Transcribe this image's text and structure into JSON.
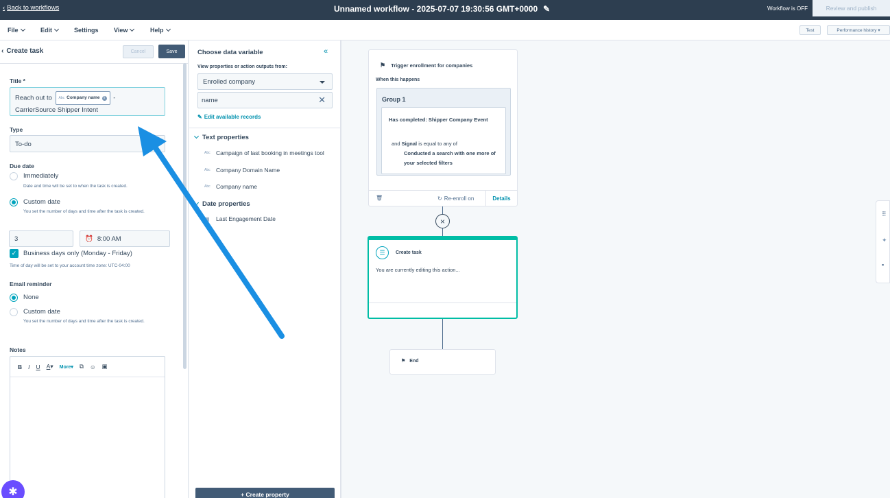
{
  "topbar": {
    "back_label": "Back to workflows",
    "title": "Unnamed workflow - 2025-07-07 19:30:56 GMT+0000",
    "status": "Workflow is OFF",
    "review_label": "Review and publish"
  },
  "menu": {
    "items": [
      "File",
      "Edit",
      "Settings",
      "View",
      "Help"
    ],
    "test_label": "Test",
    "perf_label": "Performance history"
  },
  "left": {
    "title": "Create task",
    "cancel": "Cancel",
    "save": "Save",
    "title_label": "Title *",
    "title_prefix": "Reach out to",
    "token_label": "Company name",
    "token_abc": "Abc",
    "title_suffix": "-",
    "title_line2": "CarrierSource Shipper Intent",
    "type_label": "Type",
    "type_value": "To-do",
    "due_label": "Due date",
    "immediately": "Immediately",
    "immediately_help": "Date and time will be set to when the task is created.",
    "custom_date": "Custom date",
    "custom_help": "You set the number of days and time after the task is created.",
    "days_value": "3",
    "time_value": "8:00 AM",
    "business_days": "Business days only (Monday - Friday)",
    "tz_note": "Time of day will be set to your account time zone: UTC-04:00",
    "reminder_label": "Email reminder",
    "none": "None",
    "reminder_custom": "Custom date",
    "reminder_help": "You set the number of days and time after the task is created.",
    "notes_label": "Notes",
    "toolbar": {
      "bold": "B",
      "italic": "I",
      "underline": "U",
      "color": "A",
      "more": "More"
    }
  },
  "middle": {
    "title": "Choose data variable",
    "sub": "View properties or action outputs from:",
    "source_value": "Enrolled company",
    "search_value": "name",
    "edit_records": "Edit available records",
    "text_section": "Text properties",
    "text_items": [
      "Campaign of last booking in meetings tool",
      "Company Domain Name",
      "Company name"
    ],
    "abc": "Abc",
    "date_section": "Date properties",
    "date_items": [
      "Last Engagement Date"
    ],
    "create_property": "Create property"
  },
  "canvas": {
    "trigger_title": "Trigger enrollment for companies",
    "when": "When this happens",
    "group": "Group 1",
    "cond_title": "Has completed: Shipper Company Event",
    "cond_and": "and",
    "cond_signal": "Signal",
    "cond_is": "is equal to any of",
    "cond_value": "Conducted a search with one more of your selected filters",
    "reenroll": "Re-enroll on",
    "details": "Details",
    "action_title": "Create task",
    "action_msg": "You are currently editing this action...",
    "end": "End"
  },
  "colors": {
    "accent": "#00a4bd",
    "arrow": "#1a8fe3",
    "dark": "#2d3e50",
    "action_border": "#00bda5"
  }
}
